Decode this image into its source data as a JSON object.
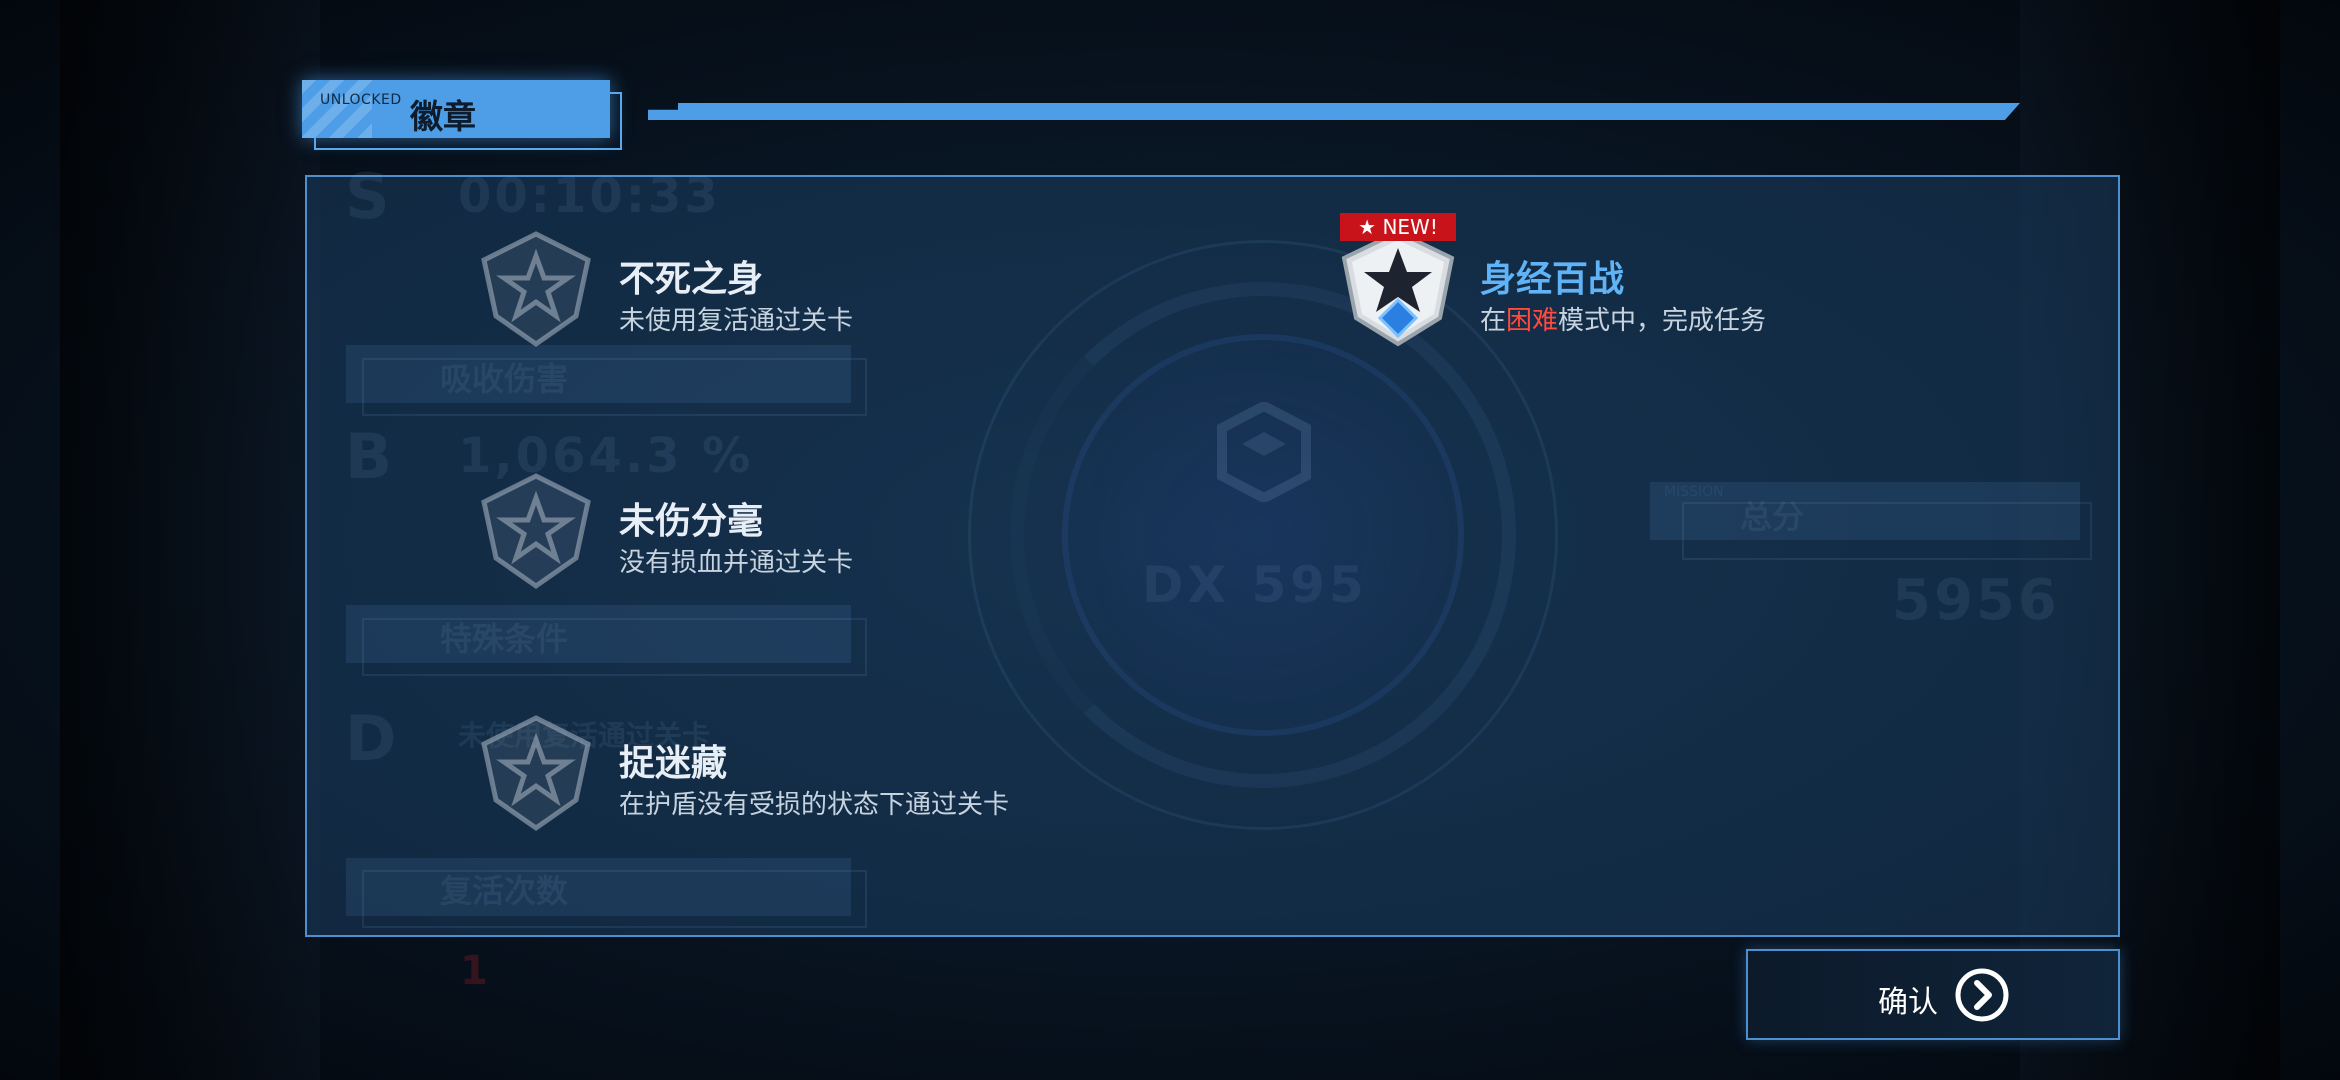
{
  "header": {
    "unlocked_label": "UNLOCKED",
    "title": "徽章"
  },
  "background_ghost": {
    "rank_s": "S",
    "time": "00:10:33",
    "absorb_label": "吸收伤害",
    "rank_b": "B",
    "absorb_value": "1,064.3 %",
    "special_label": "特殊条件",
    "rank_d": "D",
    "special_value": "未使用复活通过关卡",
    "revive_label": "复活次数",
    "revive_value": "1",
    "emblem_text": "DX 595",
    "total_label": "总分",
    "total_value": "5956",
    "mission_tag": "MISSION"
  },
  "badges": [
    {
      "name": "不死之身",
      "desc": "未使用复活通过关卡",
      "state": "locked"
    },
    {
      "name": "未伤分毫",
      "desc": "没有损血并通过关卡",
      "state": "locked"
    },
    {
      "name": "捉迷藏",
      "desc": "在护盾没有受损的状态下通过关卡",
      "state": "locked"
    }
  ],
  "new_badge": {
    "flag": "★ NEW!",
    "name": "身经百战",
    "desc_prefix": "在",
    "desc_highlight": "困难",
    "desc_suffix": "模式中，完成任务",
    "state": "unlocked"
  },
  "confirm": {
    "label": "确认",
    "icon": "chevron-right-circle-icon"
  },
  "colors": {
    "accent": "#4d9ee6",
    "active_text": "#5fb3f6",
    "highlight": "#ff4a3d",
    "new_flag": "#c8131b"
  }
}
